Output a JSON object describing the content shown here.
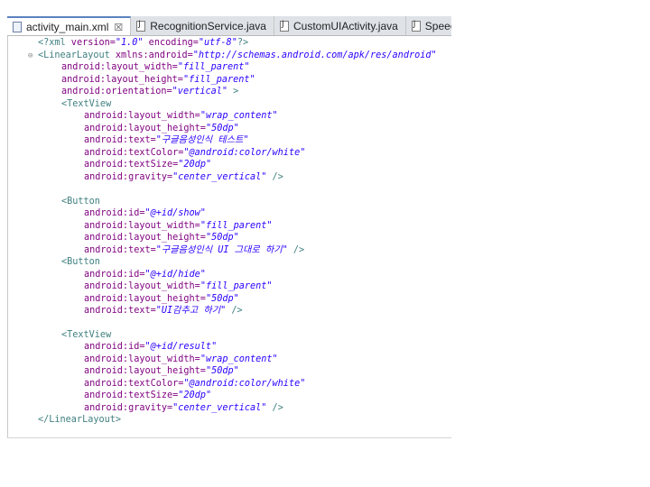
{
  "tabs": [
    {
      "label": "activity_main.xml",
      "close": "☒",
      "type": "xml",
      "active": true
    },
    {
      "label": "RecognitionService.java",
      "type": "java"
    },
    {
      "label": "CustomUIActivity.java",
      "type": "java"
    },
    {
      "label": "Speech",
      "type": "java"
    }
  ],
  "code": {
    "l1": {
      "a": "<?xml",
      "b": " version=",
      "c": "\"1.0\"",
      "d": " encoding=",
      "e": "\"utf-8\"",
      "f": "?>"
    },
    "l2": {
      "a": "<LinearLayout",
      "b": " xmlns:android=",
      "c": "\"http://schemas.android.com/apk/res/android\""
    },
    "l3": {
      "b": "android:layout_width=",
      "c": "\"fill_parent\""
    },
    "l4": {
      "b": "android:layout_height=",
      "c": "\"fill_parent\""
    },
    "l5": {
      "b": "android:orientation=",
      "c": "\"vertical\"",
      "f": " >"
    },
    "l6": {
      "a": "<TextView"
    },
    "l7": {
      "b": "android:layout_width=",
      "c": "\"wrap_content\""
    },
    "l8": {
      "b": "android:layout_height=",
      "c": "\"50dp\""
    },
    "l9": {
      "b": "android:text=",
      "c": "\"구글음성인식 테스트\""
    },
    "l10": {
      "b": "android:textColor=",
      "c": "\"@android:color/white\""
    },
    "l11": {
      "b": "android:textSize=",
      "c": "\"20dp\""
    },
    "l12": {
      "b": "android:gravity=",
      "c": "\"center_vertical\"",
      "f": " />"
    },
    "l13": {
      "a": "<Button"
    },
    "l14": {
      "b": "android:id=",
      "c": "\"@+id/show\""
    },
    "l15": {
      "b": "android:layout_width=",
      "c": "\"fill_parent\""
    },
    "l16": {
      "b": "android:layout_height=",
      "c": "\"50dp\""
    },
    "l17": {
      "b": "android:text=",
      "c": "\"구글음성인식 UI 그대로 하기\"",
      "f": " />"
    },
    "l18": {
      "a": "<Button"
    },
    "l19": {
      "b": "android:id=",
      "c": "\"@+id/hide\""
    },
    "l20": {
      "b": "android:layout_width=",
      "c": "\"fill_parent\""
    },
    "l21": {
      "b": "android:layout_height=",
      "c": "\"50dp\""
    },
    "l22": {
      "b": "android:text=",
      "c": "\"UI감추고 하기\"",
      "f": " />"
    },
    "l23": {
      "a": "<TextView"
    },
    "l24": {
      "b": "android:id=",
      "c": "\"@+id/result\""
    },
    "l25": {
      "b": "android:layout_width=",
      "c": "\"wrap_content\""
    },
    "l26": {
      "b": "android:layout_height=",
      "c": "\"50dp\""
    },
    "l27": {
      "b": "android:textColor=",
      "c": "\"@android:color/white\""
    },
    "l28": {
      "b": "android:textSize=",
      "c": "\"20dp\""
    },
    "l29": {
      "b": "android:gravity=",
      "c": "\"center_vertical\"",
      "f": " />"
    },
    "l30": {
      "a": "</LinearLayout>"
    }
  },
  "colors": {
    "tag": "#3f7f7f",
    "attribute": "#7f007f",
    "value": "#2a00ff"
  }
}
